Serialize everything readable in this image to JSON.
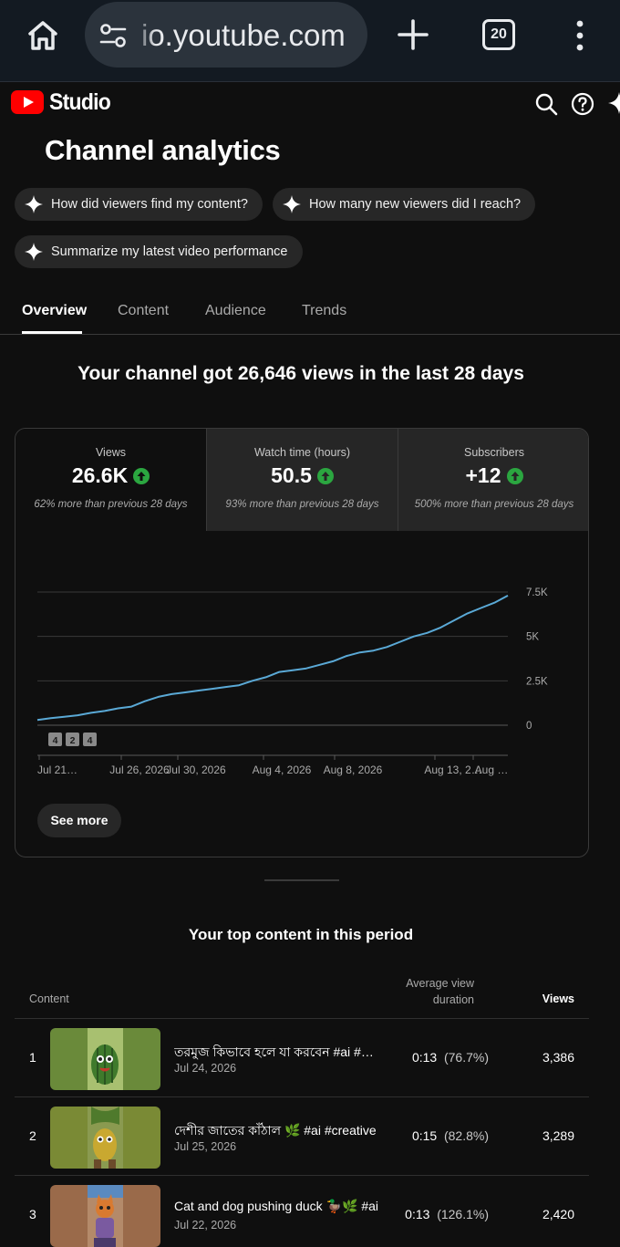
{
  "browser": {
    "url": "io.youtube.com",
    "tab_count": "20"
  },
  "studio": {
    "logo_text": "Studio"
  },
  "page_title": "Channel analytics",
  "chips": [
    {
      "label": "How did viewers find my content?"
    },
    {
      "label": "How many new viewers did I reach?"
    },
    {
      "label": "Summarize my latest video performance"
    }
  ],
  "tabs": [
    {
      "label": "Overview",
      "active": true
    },
    {
      "label": "Content",
      "active": false
    },
    {
      "label": "Audience",
      "active": false
    },
    {
      "label": "Trends",
      "active": false
    }
  ],
  "headline": "Your channel got 26,646 views in the last 28 days",
  "metrics": [
    {
      "label": "Views",
      "value": "26.6K",
      "note": "62% more than previous 28 days",
      "trend": "up",
      "selected": true
    },
    {
      "label": "Watch time (hours)",
      "value": "50.5",
      "note": "93% more than previous 28 days",
      "trend": "up",
      "selected": false
    },
    {
      "label": "Subscribers",
      "value": "+12",
      "note": "500% more than previous 28 days",
      "trend": "up",
      "selected": false
    }
  ],
  "chart_data": {
    "type": "line",
    "series": [
      {
        "values": [
          300,
          400,
          480,
          560,
          700,
          800,
          950,
          1050,
          1350,
          1600,
          1750,
          1850,
          1950,
          2050,
          2150,
          2250,
          2500,
          2700,
          3000,
          3100,
          3200,
          3400,
          3600,
          3900,
          4100,
          4200,
          4400,
          4700,
          5000,
          5200,
          5500,
          5900,
          6300,
          6600,
          6900,
          7300
        ]
      }
    ],
    "x_tick_labels": [
      "Jul 21…",
      "Jul 26, 2026",
      "Jul 30, 2026",
      "Aug 4, 2026",
      "Aug 8, 2026",
      "Aug 13, 2…",
      "Aug …"
    ],
    "y_tick_labels": [
      "0",
      "2.5K",
      "5K",
      "7.5K"
    ],
    "y_ticks": [
      0,
      2500,
      5000,
      7500
    ],
    "ylim": [
      0,
      7500
    ],
    "markers": [
      "4",
      "2",
      "4"
    ],
    "line_color": "#5aa9d6",
    "grid": true
  },
  "see_more_label": "See more",
  "top_content": {
    "title": "Your top content in this period",
    "headers": {
      "content": "Content",
      "avg_duration": "Average view duration",
      "views": "Views"
    },
    "rows": [
      {
        "rank": "1",
        "title": "তরমুজ কিভাবে হলে যা করবেন #ai #shorts",
        "date": "Jul 24, 2026",
        "avg": "0:13",
        "pct": "(76.7%)",
        "views": "3,386",
        "thumb_color": "#6a8a3a"
      },
      {
        "rank": "2",
        "title": "দেশীর জাতের কাঁঠাল 🌿 #ai #creative",
        "date": "Jul 25, 2026",
        "avg": "0:15",
        "pct": "(82.8%)",
        "views": "3,289",
        "thumb_color": "#7a8a35"
      },
      {
        "rank": "3",
        "title": "Cat and dog pushing duck 🦆🌿 #ai",
        "date": "Jul 22, 2026",
        "avg": "0:13",
        "pct": "(126.1%)",
        "views": "2,420",
        "thumb_color": "#9a6a4a"
      }
    ]
  },
  "colors": {
    "background": "#0f0f0f",
    "brand_red": "#ff0000",
    "trend_green": "#2ba640",
    "chart_line": "#5aa9d6"
  }
}
